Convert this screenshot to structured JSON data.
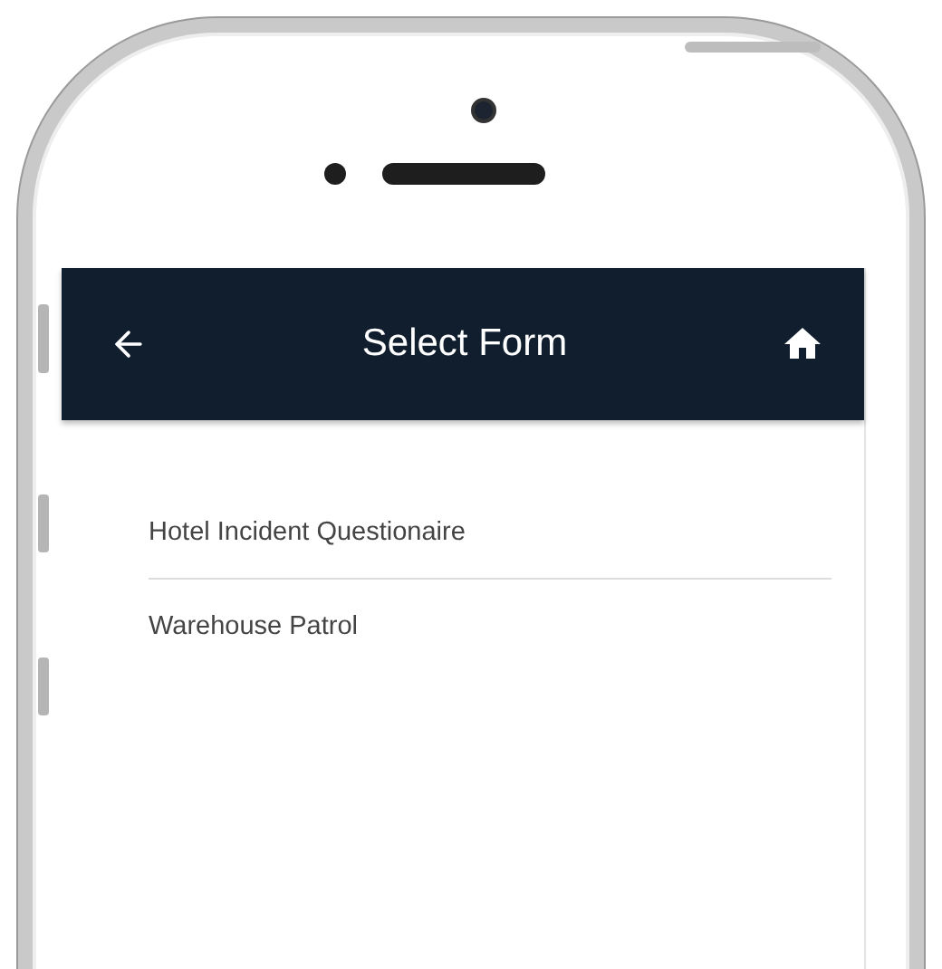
{
  "header": {
    "title": "Select Form"
  },
  "forms": [
    {
      "label": "Hotel Incident Questionaire"
    },
    {
      "label": "Warehouse Patrol"
    }
  ]
}
